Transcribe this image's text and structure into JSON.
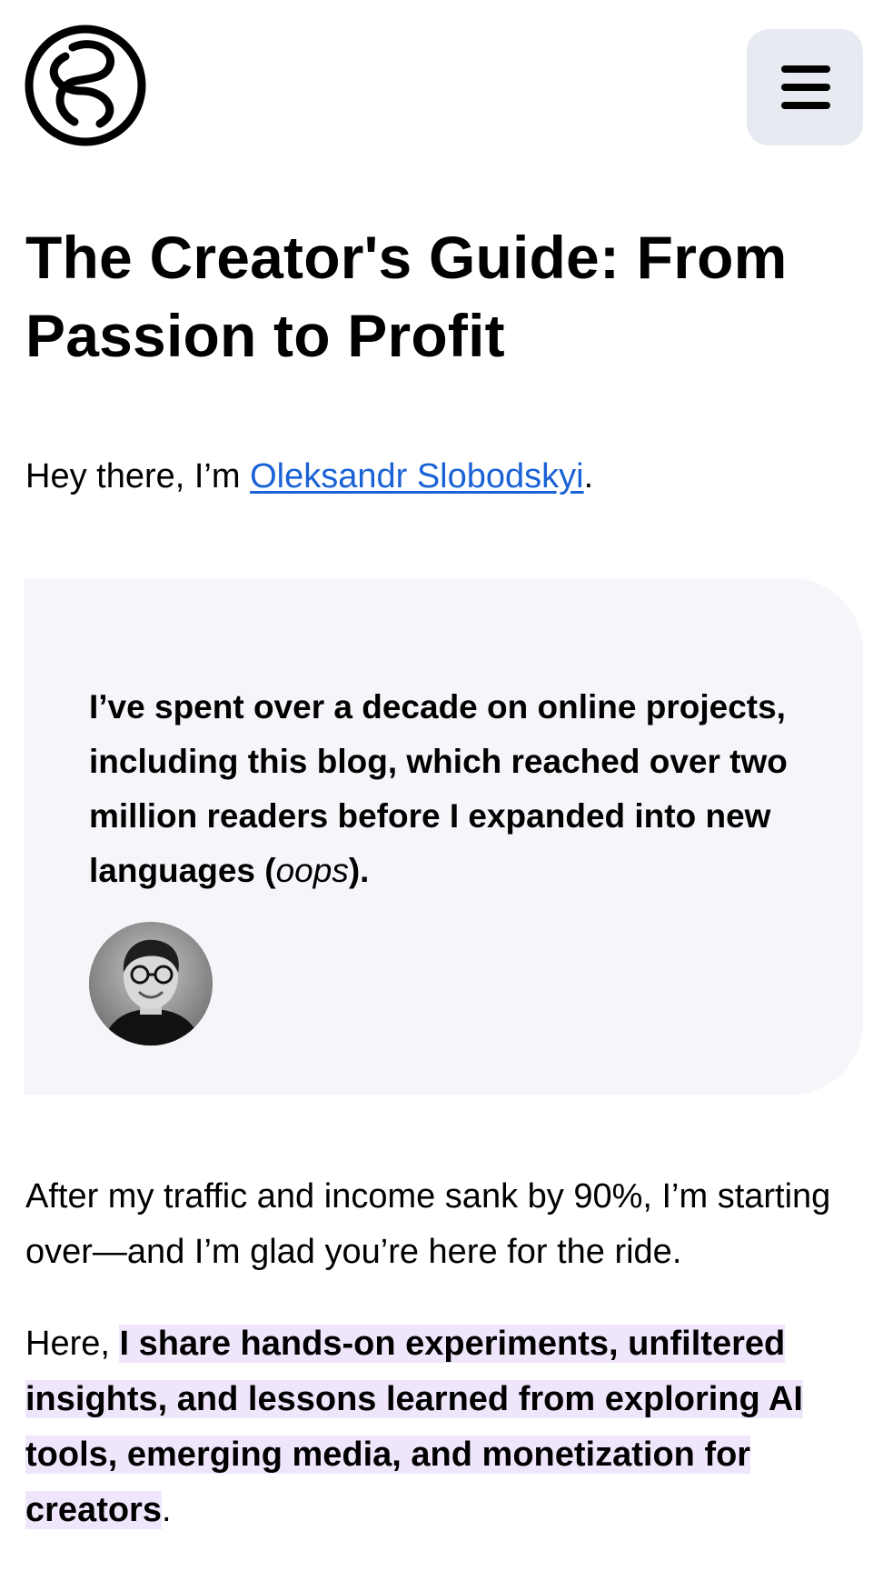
{
  "header": {
    "logo_icon": "s-circle-logo-icon",
    "menu_icon": "hamburger-menu-icon",
    "menu_bg": "#e7eaf1"
  },
  "title": "The Creator's Guide: From Passion to Profit",
  "intro": {
    "prefix": "Hey there, I’m ",
    "author_link": "Oleksandr Slobodskyi",
    "suffix": ".",
    "link_color": "#1a62d6"
  },
  "card": {
    "text_before": "I’ve spent over a decade on online projects, including this blog, which reached over two million readers before I expanded into new languages (",
    "text_italic": "oops",
    "text_after": ").",
    "background": "#f5f5fa",
    "avatar_icon": "author-avatar-photo"
  },
  "para1": "After my traffic and income sank by 90%, I’m starting over—and I’m glad you’re here for the ride.",
  "para2": {
    "prefix": "Here, ",
    "highlight": "I share hands-on experiments, unfiltered insights, and lessons learned from exploring AI tools, emerging media, and monetization for creators",
    "suffix": ".",
    "highlight_color": "#efe6fb"
  }
}
